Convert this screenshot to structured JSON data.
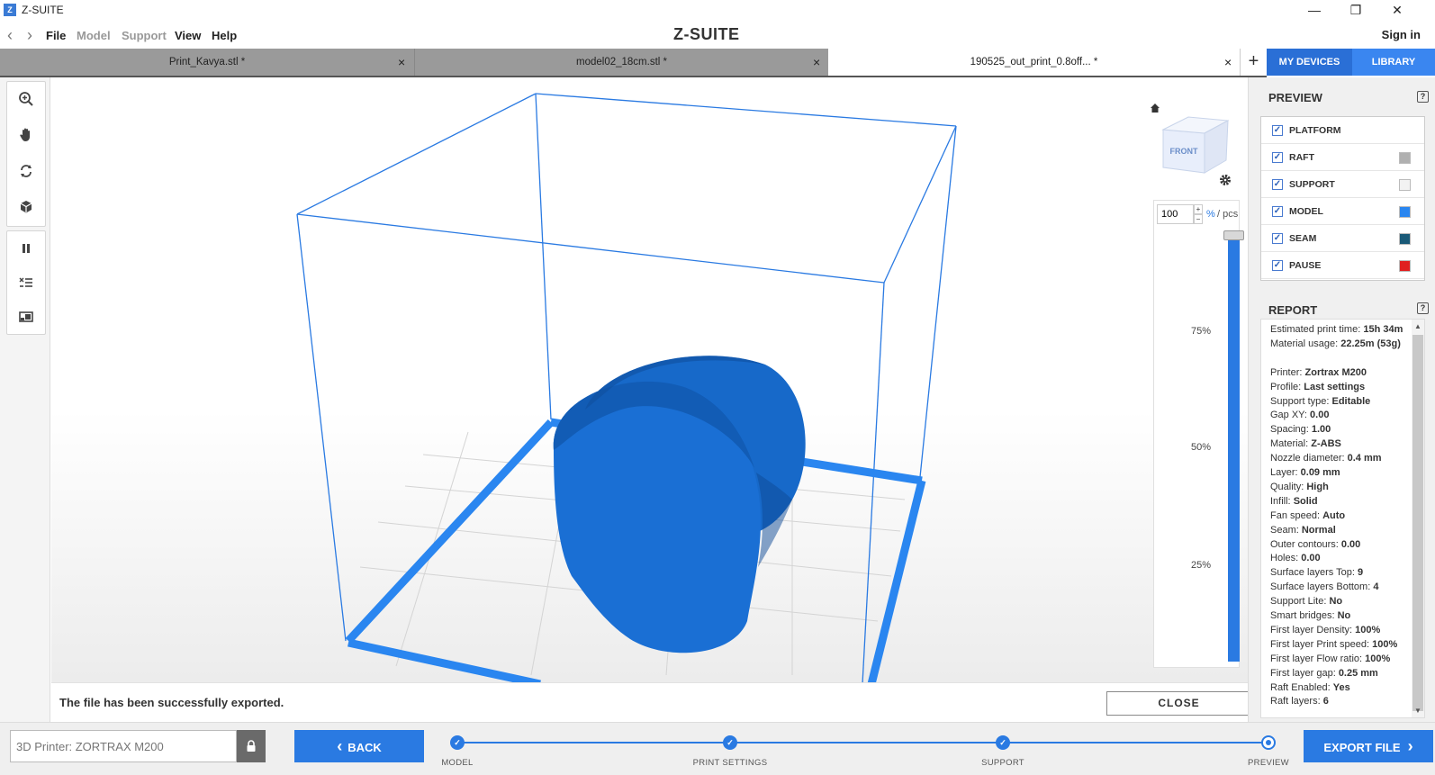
{
  "window": {
    "app_icon": "Z",
    "title": "Z-SUITE",
    "minimize": "—",
    "restore": "❐",
    "close": "✕"
  },
  "menu": {
    "back": "‹",
    "forward": "›",
    "items": [
      "File",
      "Model",
      "Support",
      "View",
      "Help"
    ],
    "logo": "Z-SUITE",
    "sign_in": "Sign in"
  },
  "tabs": [
    {
      "label": "Print_Kavya.stl *",
      "close": "×"
    },
    {
      "label": "model02_18cm.stl *",
      "close": "×"
    },
    {
      "label": "190525_out_print_0.8off... *",
      "close": "×"
    }
  ],
  "tab_add": "+",
  "header_buttons": {
    "devices": "MY DEVICES",
    "library": "LIBRARY"
  },
  "viewport": {
    "cube_face": "FRONT",
    "layer_value": "100",
    "spin_up": "+",
    "spin_down": "−",
    "unit_pct": "%",
    "unit_pcs": "/ pcs",
    "layer_level_percent": 100,
    "ticks": [
      "75%",
      "50%",
      "25%"
    ]
  },
  "status": {
    "message": "The file has been successfully exported.",
    "close_label": "CLOSE"
  },
  "preview": {
    "title": "PREVIEW",
    "help": "?",
    "items": [
      {
        "label": "PLATFORM",
        "checked": true,
        "color": ""
      },
      {
        "label": "RAFT",
        "checked": true,
        "color": "#b0b0b0"
      },
      {
        "label": "SUPPORT",
        "checked": true,
        "color": "#f2f2f2"
      },
      {
        "label": "MODEL",
        "checked": true,
        "color": "#2a86f0"
      },
      {
        "label": "SEAM",
        "checked": true,
        "color": "#1a5a78"
      },
      {
        "label": "PAUSE",
        "checked": true,
        "color": "#e02020"
      }
    ]
  },
  "report": {
    "title": "REPORT",
    "help": "?",
    "lines": [
      {
        "key": "Estimated print time: ",
        "value": "15h 34m"
      },
      {
        "key": "Material usage: ",
        "value": "22.25m (53g)"
      },
      {
        "key": "",
        "value": ""
      },
      {
        "key": "Printer: ",
        "value": "Zortrax M200"
      },
      {
        "key": "Profile: ",
        "value": "Last settings"
      },
      {
        "key": "Support type: ",
        "value": "Editable"
      },
      {
        "key": "Gap XY: ",
        "value": "0.00"
      },
      {
        "key": "Spacing: ",
        "value": "1.00"
      },
      {
        "key": "Material: ",
        "value": "Z-ABS"
      },
      {
        "key": "Nozzle diameter: ",
        "value": "0.4 mm"
      },
      {
        "key": "Layer: ",
        "value": "0.09 mm"
      },
      {
        "key": "Quality: ",
        "value": "High"
      },
      {
        "key": "Infill: ",
        "value": "Solid"
      },
      {
        "key": "Fan speed: ",
        "value": "Auto"
      },
      {
        "key": "Seam: ",
        "value": "Normal"
      },
      {
        "key": "Outer contours: ",
        "value": "0.00"
      },
      {
        "key": "Holes: ",
        "value": "0.00"
      },
      {
        "key": "Surface layers Top: ",
        "value": "9"
      },
      {
        "key": "Surface layers Bottom: ",
        "value": "4"
      },
      {
        "key": "Support Lite: ",
        "value": "No"
      },
      {
        "key": "Smart bridges: ",
        "value": "No"
      },
      {
        "key": "First layer Density: ",
        "value": "100%"
      },
      {
        "key": "First layer Print speed: ",
        "value": "100%"
      },
      {
        "key": "First layer Flow ratio: ",
        "value": "100%"
      },
      {
        "key": "First layer gap: ",
        "value": "0.25 mm"
      },
      {
        "key": "Raft Enabled: ",
        "value": "Yes"
      },
      {
        "key": "Raft layers: ",
        "value": "6"
      }
    ]
  },
  "bottom": {
    "printer_placeholder": "3D Printer: ZORTRAX M200",
    "back_label": "BACK",
    "back_arrow": "‹",
    "export_label": "EXPORT FILE",
    "export_arrow": "›",
    "steps": [
      {
        "label": "MODEL",
        "done": true
      },
      {
        "label": "PRINT SETTINGS",
        "done": true
      },
      {
        "label": "SUPPORT",
        "done": true
      },
      {
        "label": "PREVIEW",
        "done": false
      }
    ],
    "check": "✓"
  },
  "colors": {
    "accent": "#2a7ae2",
    "model": "#1565c8",
    "build_box": "#2a7ae2"
  },
  "icons": {
    "zoom": "zoom-icon",
    "pan": "hand-icon",
    "rotate": "rotate-icon",
    "view": "cube-icon",
    "pause": "pause-icon",
    "layers": "layers-icon",
    "screen": "screen-icon",
    "home": "home-icon",
    "settings": "gear-icon",
    "lock": "lock-icon"
  }
}
